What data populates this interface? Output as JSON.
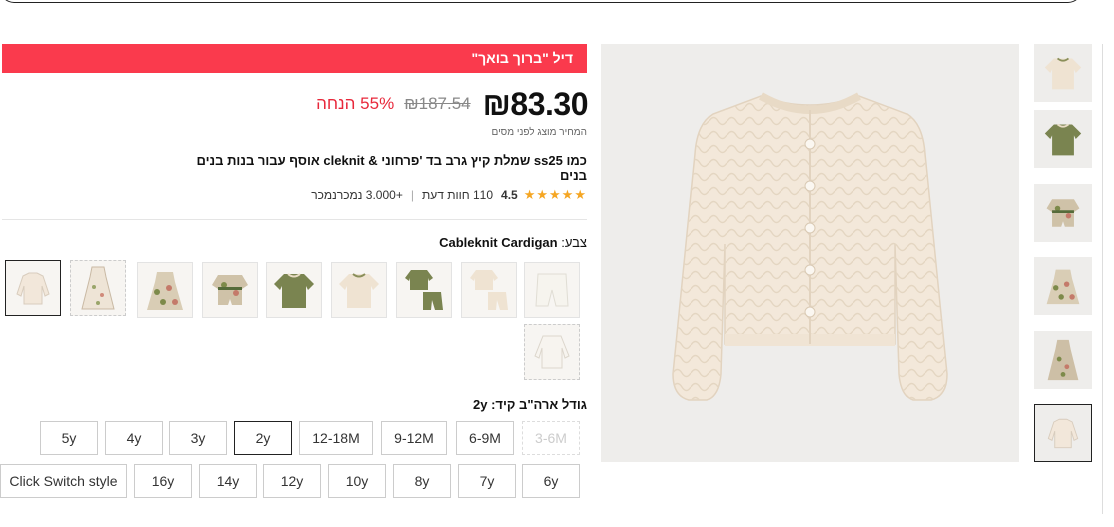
{
  "deal": {
    "label": "דיל \"ברוך בואך\""
  },
  "price": {
    "current": "₪83.30",
    "original": "₪187.54",
    "discount": "55% הנחה",
    "tax_note": "המחיר מוצג לפני מסים"
  },
  "product": {
    "title": "כמו ss25 שמלת קיץ גרב בד 'פרחוני & cleknit אוסף עבור בנות בנים בנים"
  },
  "rating": {
    "score": "4.5",
    "reviews": "110 חוות דעת",
    "sold": "+3.000 נמכרנמכר"
  },
  "color": {
    "label": "צבע:",
    "value": "Cableknit Cardigan"
  },
  "swatches": [
    {
      "name": "cardigan",
      "selected": true
    },
    {
      "name": "floral-long-dress"
    },
    {
      "name": "floral-dress"
    },
    {
      "name": "floral-romper"
    },
    {
      "name": "olive-top"
    },
    {
      "name": "cream-top"
    },
    {
      "name": "olive-set"
    },
    {
      "name": "cream-set"
    },
    {
      "name": "white-shorts"
    },
    {
      "name": "cream-cardigan"
    }
  ],
  "size_section": {
    "label": "גודל ארה\"ב קיד: 2y"
  },
  "sizes_row1": [
    "3-6M",
    "6-9M",
    "9-12M",
    "12-18M",
    "2y",
    "3y",
    "4y",
    "5y"
  ],
  "sizes_row2": [
    "6y",
    "7y",
    "8y",
    "10y",
    "12y",
    "14y",
    "16y",
    "Click Switch style"
  ],
  "thumbs": [
    "cream-top",
    "olive-top",
    "floral-romper",
    "floral-dress",
    "floral-long-dress",
    "cardigan"
  ],
  "colors": {
    "deal": "#fa3a4d",
    "discount": "#e8283b",
    "star": "#f5a623"
  }
}
